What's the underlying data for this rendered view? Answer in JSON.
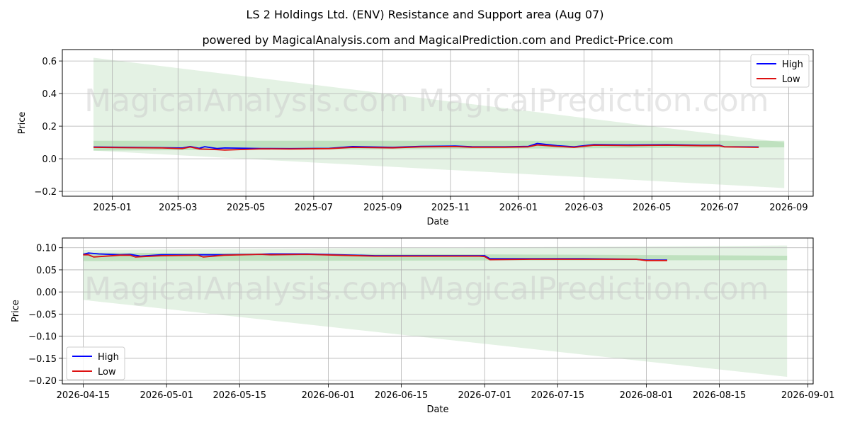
{
  "title": "LS 2 Holdings Ltd. (ENV) Resistance and Support area (Aug 07)",
  "subtitle": "powered by MagicalAnalysis.com and MagicalPrediction.com and Predict-Price.com",
  "watermarks": [
    "MagicalAnalysis.com",
    "MagicalPrediction.com"
  ],
  "colors": {
    "high": "#0000ff",
    "low": "#dd1111",
    "band": "#2e9e2e"
  },
  "chart_data": [
    {
      "type": "line",
      "xlabel": "Date",
      "ylabel": "Price",
      "x_ticks": [
        "2025-01",
        "2025-03",
        "2025-05",
        "2025-07",
        "2025-09",
        "2025-11",
        "2026-01",
        "2026-03",
        "2026-05",
        "2026-07",
        "2026-09"
      ],
      "y_ticks": [
        "−0.2",
        "0.0",
        "0.2",
        "0.4",
        "0.6"
      ],
      "ylim": [
        -0.23,
        0.67
      ],
      "grid": true,
      "legend": "top-right",
      "series": [
        {
          "name": "High",
          "points": [
            [
              "2024-12-15",
              0.072
            ],
            [
              "2025-01-15",
              0.07
            ],
            [
              "2025-02-15",
              0.068
            ],
            [
              "2025-03-05",
              0.066
            ],
            [
              "2025-03-12",
              0.075
            ],
            [
              "2025-03-20",
              0.064
            ],
            [
              "2025-03-25",
              0.074
            ],
            [
              "2025-04-05",
              0.063
            ],
            [
              "2025-04-12",
              0.066
            ],
            [
              "2025-05-15",
              0.063
            ],
            [
              "2025-06-10",
              0.062
            ],
            [
              "2025-07-15",
              0.064
            ],
            [
              "2025-08-05",
              0.075
            ],
            [
              "2025-09-10",
              0.07
            ],
            [
              "2025-10-05",
              0.076
            ],
            [
              "2025-11-05",
              0.078
            ],
            [
              "2025-11-20",
              0.074
            ],
            [
              "2025-12-20",
              0.073
            ],
            [
              "2026-01-10",
              0.076
            ],
            [
              "2026-01-18",
              0.094
            ],
            [
              "2026-02-05",
              0.08
            ],
            [
              "2026-02-20",
              0.073
            ],
            [
              "2026-03-10",
              0.087
            ],
            [
              "2026-04-10",
              0.085
            ],
            [
              "2026-05-15",
              0.086
            ],
            [
              "2026-06-15",
              0.082
            ],
            [
              "2026-07-01",
              0.082
            ],
            [
              "2026-07-05",
              0.074
            ],
            [
              "2026-08-05",
              0.072
            ]
          ]
        },
        {
          "name": "Low",
          "points": [
            [
              "2024-12-15",
              0.07
            ],
            [
              "2025-01-15",
              0.068
            ],
            [
              "2025-02-15",
              0.066
            ],
            [
              "2025-03-05",
              0.062
            ],
            [
              "2025-03-12",
              0.072
            ],
            [
              "2025-03-20",
              0.06
            ],
            [
              "2025-04-05",
              0.056
            ],
            [
              "2025-04-12",
              0.053
            ],
            [
              "2025-05-15",
              0.061
            ],
            [
              "2025-06-10",
              0.06
            ],
            [
              "2025-07-15",
              0.062
            ],
            [
              "2025-08-05",
              0.07
            ],
            [
              "2025-09-10",
              0.067
            ],
            [
              "2025-10-05",
              0.073
            ],
            [
              "2025-11-05",
              0.075
            ],
            [
              "2025-11-20",
              0.071
            ],
            [
              "2025-12-20",
              0.071
            ],
            [
              "2026-01-10",
              0.073
            ],
            [
              "2026-01-18",
              0.085
            ],
            [
              "2026-02-05",
              0.076
            ],
            [
              "2026-02-20",
              0.07
            ],
            [
              "2026-03-10",
              0.083
            ],
            [
              "2026-04-10",
              0.081
            ],
            [
              "2026-05-15",
              0.083
            ],
            [
              "2026-06-15",
              0.08
            ],
            [
              "2026-07-01",
              0.08
            ],
            [
              "2026-07-05",
              0.073
            ],
            [
              "2026-08-05",
              0.07
            ]
          ]
        }
      ],
      "bands": [
        {
          "upper": [
            [
              "2024-12-15",
              0.62
            ],
            [
              "2026-08-28",
              0.1
            ]
          ],
          "lower": [
            [
              "2024-12-15",
              0.05
            ],
            [
              "2026-08-28",
              -0.18
            ]
          ]
        },
        {
          "upper": [
            [
              "2024-12-15",
              0.11
            ],
            [
              "2026-08-28",
              0.11
            ]
          ],
          "lower": [
            [
              "2024-12-15",
              0.05
            ],
            [
              "2026-08-28",
              0.07
            ]
          ]
        }
      ]
    },
    {
      "type": "line",
      "xlabel": "Date",
      "ylabel": "Price",
      "x_ticks": [
        "2026-04-15",
        "2026-05-01",
        "2026-05-15",
        "2026-06-01",
        "2026-06-15",
        "2026-07-01",
        "2026-07-15",
        "2026-08-01",
        "2026-08-15",
        "2026-09-01"
      ],
      "y_ticks": [
        "−0.20",
        "−0.15",
        "−0.10",
        "−0.05",
        "0.00",
        "0.05",
        "0.10"
      ],
      "ylim": [
        -0.208,
        0.122
      ],
      "grid": true,
      "legend": "bottom-left",
      "series": [
        {
          "name": "High",
          "points": [
            [
              "2026-04-15",
              0.085
            ],
            [
              "2026-04-16",
              0.088
            ],
            [
              "2026-04-18",
              0.086
            ],
            [
              "2026-04-22",
              0.084
            ],
            [
              "2026-04-24",
              0.085
            ],
            [
              "2026-04-26",
              0.081
            ],
            [
              "2026-04-30",
              0.084
            ],
            [
              "2026-05-07",
              0.084
            ],
            [
              "2026-05-12",
              0.084
            ],
            [
              "2026-05-18",
              0.085
            ],
            [
              "2026-05-21",
              0.086
            ],
            [
              "2026-05-28",
              0.086
            ],
            [
              "2026-06-03",
              0.084
            ],
            [
              "2026-06-10",
              0.082
            ],
            [
              "2026-06-20",
              0.082
            ],
            [
              "2026-06-30",
              0.082
            ],
            [
              "2026-07-01",
              0.082
            ],
            [
              "2026-07-02",
              0.075
            ],
            [
              "2026-07-10",
              0.075
            ],
            [
              "2026-07-20",
              0.075
            ],
            [
              "2026-07-30",
              0.074
            ],
            [
              "2026-08-01",
              0.072
            ],
            [
              "2026-08-05",
              0.072
            ]
          ]
        },
        {
          "name": "Low",
          "points": [
            [
              "2026-04-15",
              0.084
            ],
            [
              "2026-04-16",
              0.084
            ],
            [
              "2026-04-17",
              0.079
            ],
            [
              "2026-04-22",
              0.083
            ],
            [
              "2026-04-24",
              0.083
            ],
            [
              "2026-04-25",
              0.079
            ],
            [
              "2026-04-30",
              0.082
            ],
            [
              "2026-05-07",
              0.083
            ],
            [
              "2026-05-08",
              0.079
            ],
            [
              "2026-05-12",
              0.083
            ],
            [
              "2026-05-19",
              0.085
            ],
            [
              "2026-05-21",
              0.084
            ],
            [
              "2026-05-28",
              0.085
            ],
            [
              "2026-06-03",
              0.083
            ],
            [
              "2026-06-10",
              0.081
            ],
            [
              "2026-06-20",
              0.081
            ],
            [
              "2026-06-30",
              0.081
            ],
            [
              "2026-07-01",
              0.08
            ],
            [
              "2026-07-02",
              0.073
            ],
            [
              "2026-07-10",
              0.074
            ],
            [
              "2026-07-20",
              0.074
            ],
            [
              "2026-07-30",
              0.074
            ],
            [
              "2026-08-01",
              0.071
            ],
            [
              "2026-08-05",
              0.071
            ]
          ]
        }
      ],
      "bands": [
        {
          "upper": [
            [
              "2026-04-15",
              0.095
            ],
            [
              "2026-08-28",
              0.105
            ]
          ],
          "lower": [
            [
              "2026-04-15",
              -0.018
            ],
            [
              "2026-08-28",
              -0.192
            ]
          ]
        },
        {
          "upper": [
            [
              "2026-04-15",
              0.089
            ],
            [
              "2026-08-28",
              0.082
            ]
          ],
          "lower": [
            [
              "2026-04-15",
              0.07
            ],
            [
              "2026-08-28",
              0.072
            ]
          ]
        }
      ]
    }
  ]
}
